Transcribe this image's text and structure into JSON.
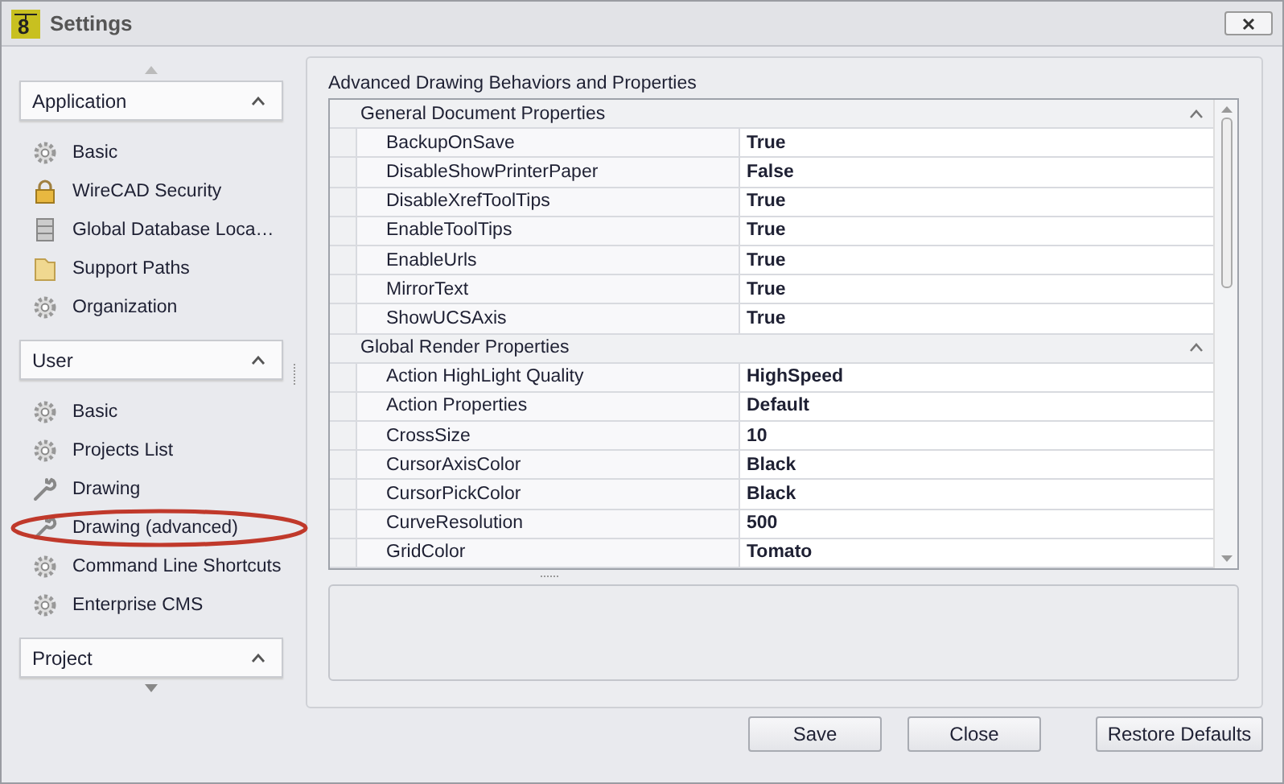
{
  "window": {
    "title": "Settings",
    "logo": "8"
  },
  "sidebar": {
    "groups": [
      {
        "label": "Application",
        "expanded": true,
        "items": [
          {
            "label": "Basic",
            "highlighted": false
          },
          {
            "label": "WireCAD Security",
            "highlighted": false
          },
          {
            "label": "Global Database Loca…",
            "highlighted": false
          },
          {
            "label": "Support Paths",
            "highlighted": false
          },
          {
            "label": "Organization",
            "highlighted": false
          }
        ]
      },
      {
        "label": "User",
        "expanded": true,
        "items": [
          {
            "label": "Basic",
            "highlighted": false
          },
          {
            "label": "Projects List",
            "highlighted": false
          },
          {
            "label": "Drawing",
            "highlighted": false
          },
          {
            "label": "Drawing (advanced)",
            "highlighted": true
          },
          {
            "label": "Command Line Shortcuts",
            "highlighted": false
          },
          {
            "label": "Enterprise CMS",
            "highlighted": false
          }
        ]
      },
      {
        "label": "Project",
        "expanded": true
      }
    ]
  },
  "panel": {
    "title": "Advanced Drawing Behaviors and Properties",
    "categories": [
      {
        "label": "General Document Properties",
        "expanded": true,
        "rows": [
          {
            "name": "BackupOnSave",
            "value": "True"
          },
          {
            "name": "DisableShowPrinterPaper",
            "value": "False"
          },
          {
            "name": "DisableXrefToolTips",
            "value": "True"
          },
          {
            "name": "EnableToolTips",
            "value": "True"
          },
          {
            "name": "EnableUrls",
            "value": "True"
          },
          {
            "name": "MirrorText",
            "value": "True"
          },
          {
            "name": "ShowUCSAxis",
            "value": "True"
          }
        ]
      },
      {
        "label": "Global Render Properties",
        "expanded": true,
        "rows": [
          {
            "name": "Action HighLight Quality",
            "value": "HighSpeed"
          },
          {
            "name": "Action Properties",
            "value": "Default"
          },
          {
            "name": "CrossSize",
            "value": "10"
          },
          {
            "name": "CursorAxisColor",
            "value": "Black"
          },
          {
            "name": "CursorPickColor",
            "value": "Black"
          },
          {
            "name": "CurveResolution",
            "value": "500"
          },
          {
            "name": "GridColor",
            "value": "Tomato"
          }
        ]
      }
    ]
  },
  "buttons": [
    "Save",
    "Close",
    "Restore Defaults"
  ]
}
